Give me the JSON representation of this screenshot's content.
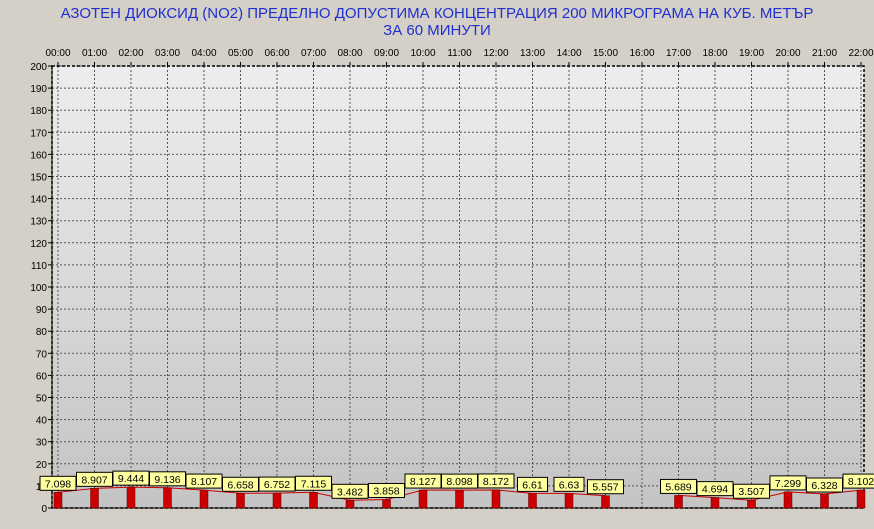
{
  "chart_data": {
    "type": "bar",
    "title": "АЗОТЕН ДИОКСИД   (NO2)     ПРЕДЕЛНО ДОПУСТИМА КОНЦЕНТРАЦИЯ 200 МИКРОГРАМА  НА КУБ. МЕТЪР",
    "subtitle": "ЗА 60 МИНУТИ",
    "xlabel": "",
    "ylabel": "",
    "ylim": [
      0,
      200
    ],
    "yticks": [
      0,
      10,
      20,
      30,
      40,
      50,
      60,
      70,
      80,
      90,
      100,
      110,
      120,
      130,
      140,
      150,
      160,
      170,
      180,
      190,
      200
    ],
    "categories": [
      "00:00",
      "01:00",
      "02:00",
      "03:00",
      "04:00",
      "05:00",
      "06:00",
      "07:00",
      "08:00",
      "09:00",
      "10:00",
      "11:00",
      "12:00",
      "13:00",
      "14:00",
      "15:00",
      "16:00",
      "17:00",
      "18:00",
      "19:00",
      "20:00",
      "21:00",
      "22:00"
    ],
    "values": [
      7.098,
      8.907,
      9.444,
      9.136,
      8.107,
      6.658,
      6.752,
      7.115,
      3.482,
      3.858,
      8.127,
      8.098,
      8.172,
      6.61,
      6.63,
      5.557,
      null,
      5.689,
      4.694,
      3.507,
      7.299,
      6.328,
      8.102
    ],
    "labels": [
      "7.098",
      "8.907",
      "9.444",
      "9.136",
      "8.107",
      "6.658",
      "6.752",
      "7.115",
      "3.482",
      "3.858",
      "8.127",
      "8.098",
      "8.172",
      "6.61",
      "6.63",
      "5.557",
      "",
      "5.689",
      "4.694",
      "3.507",
      "7.299",
      "6.328",
      "8.102"
    ],
    "grid": true,
    "colors": {
      "title": "#1f2fd0",
      "bar": "#cc0000",
      "label_bg": "#ffffa0",
      "plot_bg_top": "#ededed",
      "plot_bg_bottom": "#c4c4c4",
      "line": "#cc0000"
    }
  }
}
